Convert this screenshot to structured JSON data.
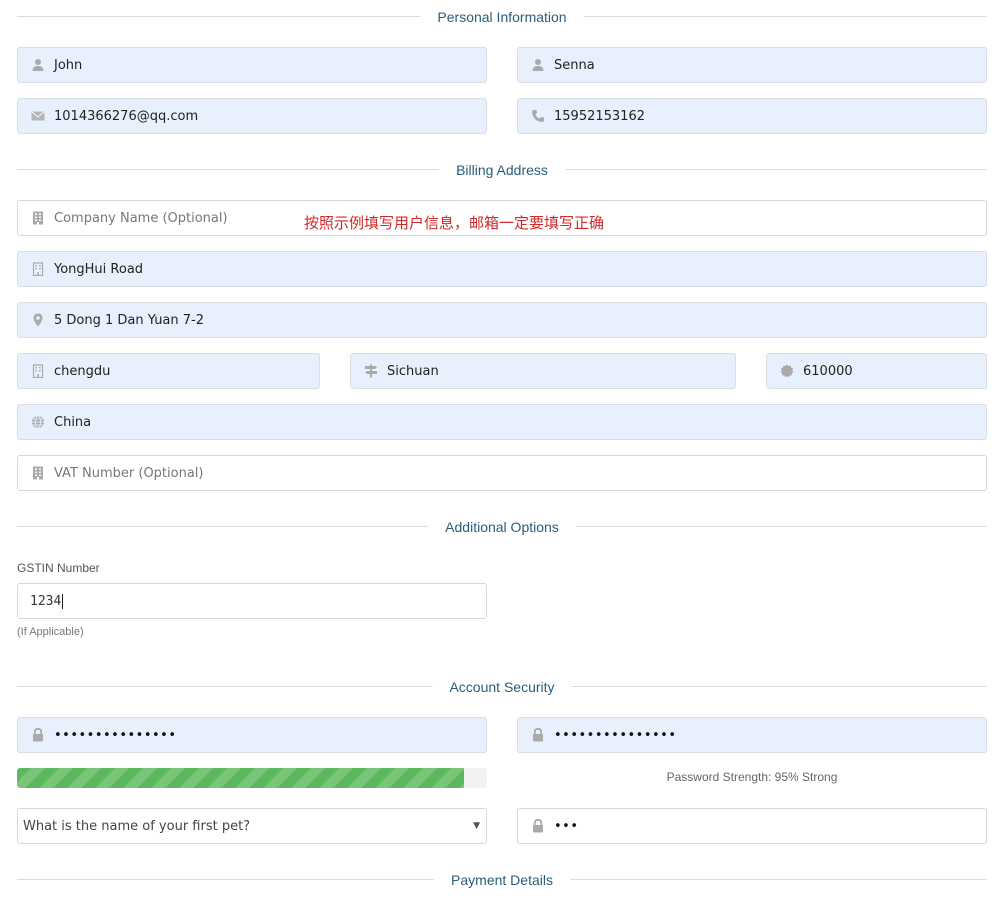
{
  "sections": {
    "personal": "Personal Information",
    "billing": "Billing Address",
    "additional": "Additional Options",
    "security": "Account Security",
    "payment": "Payment Details"
  },
  "personal": {
    "first_name": {
      "value": "John",
      "icon": "user-icon"
    },
    "last_name": {
      "value": "Senna",
      "icon": "user-icon"
    },
    "email": {
      "value": "1014366276@qq.com",
      "icon": "envelope-icon"
    },
    "phone": {
      "value": "15952153162",
      "icon": "phone-icon"
    }
  },
  "billing": {
    "company": {
      "placeholder": "Company Name (Optional)",
      "value": "",
      "icon": "building-icon"
    },
    "address1": {
      "value": "YongHui Road",
      "icon": "building-icon"
    },
    "address2": {
      "value": "5 Dong 1 Dan Yuan 7-2",
      "icon": "map-marker-icon"
    },
    "city": {
      "value": "chengdu",
      "icon": "building-icon"
    },
    "state": {
      "value": "Sichuan",
      "icon": "signpost-icon"
    },
    "postcode": {
      "value": "610000",
      "icon": "certificate-icon"
    },
    "country": {
      "value": "China",
      "icon": "globe-icon"
    },
    "vat": {
      "placeholder": "VAT Number (Optional)",
      "value": "",
      "icon": "building-icon"
    },
    "annotation": "按照示例填写用户信息，邮箱一定要填写正确"
  },
  "additional": {
    "gstin_label": "GSTIN Number",
    "gstin_value": "1234",
    "gstin_help": "(If Applicable)"
  },
  "security": {
    "password": {
      "value": "•••••••••••••••",
      "icon": "lock-icon"
    },
    "password_confirm": {
      "value": "•••••••••••••••",
      "icon": "lock-icon"
    },
    "strength_percent": 95,
    "strength_text": "Password Strength: 95% Strong",
    "question_selected": "What is the name of your first pet?",
    "answer": {
      "value": "•••",
      "icon": "lock-icon"
    }
  },
  "colors": {
    "section_title": "#2a5d7c",
    "filled_bg": "#e8f0fe",
    "progress": "#5cb85c",
    "annotation": "#d0282a"
  }
}
